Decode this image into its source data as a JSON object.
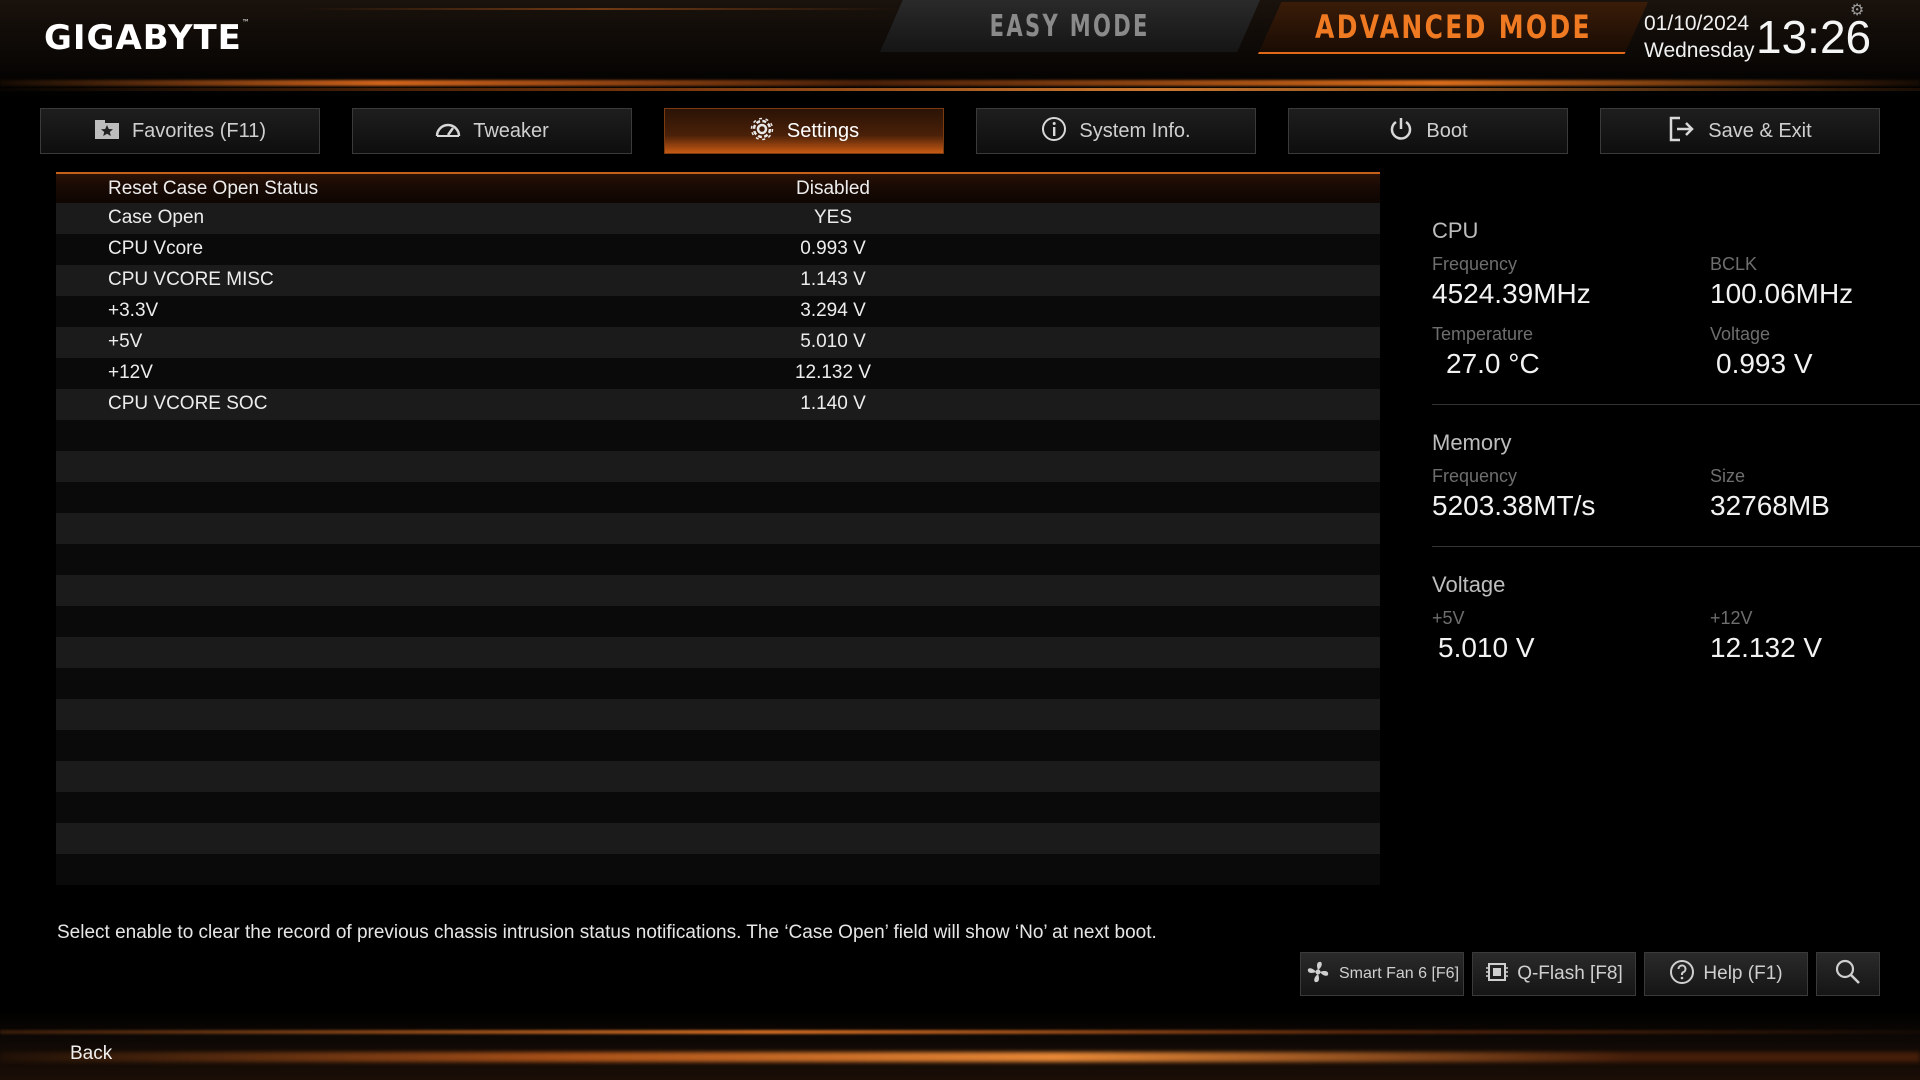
{
  "header": {
    "brand": "GIGABYTE",
    "brand_tm": "™",
    "mode_easy": "EASY MODE",
    "mode_advanced": "ADVANCED MODE",
    "date": "01/10/2024",
    "weekday": "Wednesday",
    "time": "13:26",
    "corner_icon": "gear-icon"
  },
  "tabs": [
    {
      "label": "Favorites (F11)",
      "icon": "star-folder-icon"
    },
    {
      "label": "Tweaker",
      "icon": "speedometer-icon"
    },
    {
      "label": "Settings",
      "icon": "gear-icon",
      "active": true
    },
    {
      "label": "System Info.",
      "icon": "info-icon"
    },
    {
      "label": "Boot",
      "icon": "power-icon"
    },
    {
      "label": "Save & Exit",
      "icon": "exit-icon"
    }
  ],
  "settings": [
    {
      "label": "Reset Case Open Status",
      "value": "Disabled"
    },
    {
      "label": "Case Open",
      "value": "YES"
    },
    {
      "label": "CPU Vcore",
      "value": "0.993 V"
    },
    {
      "label": "CPU VCORE MISC",
      "value": "1.143 V"
    },
    {
      "label": "+3.3V",
      "value": "3.294 V"
    },
    {
      "label": "+5V",
      "value": "5.010 V"
    },
    {
      "label": "+12V",
      "value": "12.132 V"
    },
    {
      "label": "CPU VCORE SOC",
      "value": "1.140 V"
    }
  ],
  "panel": {
    "cpu": {
      "title": "CPU",
      "freq_label": "Frequency",
      "freq_value": "4524.39MHz",
      "bclk_label": "BCLK",
      "bclk_value": "100.06MHz",
      "temp_label": "Temperature",
      "temp_value": "27.0 °C",
      "volt_label": "Voltage",
      "volt_value": "0.993 V"
    },
    "memory": {
      "title": "Memory",
      "freq_label": "Frequency",
      "freq_value": "5203.38MT/s",
      "size_label": "Size",
      "size_value": "32768MB"
    },
    "voltage": {
      "title": "Voltage",
      "v5_label": "+5V",
      "v5_value": "5.010 V",
      "v12_label": "+12V",
      "v12_value": "12.132 V"
    }
  },
  "help_text": "Select enable to clear the record of previous chassis intrusion status notifications. The ‘Case Open’ field will show ‘No’ at next boot.",
  "bottom_buttons": {
    "smart_fan": "Smart Fan 6 [F6]",
    "qflash": "Q-Flash [F8]",
    "help": "Help (F1)",
    "search_icon": "search-icon"
  },
  "footer": {
    "back": "Back"
  },
  "colors": {
    "accent": "#e06a1a",
    "advanced_mode_text": "#f07a22",
    "row_dark": "#0a0a0a",
    "row_light": "#1b1b1b"
  }
}
